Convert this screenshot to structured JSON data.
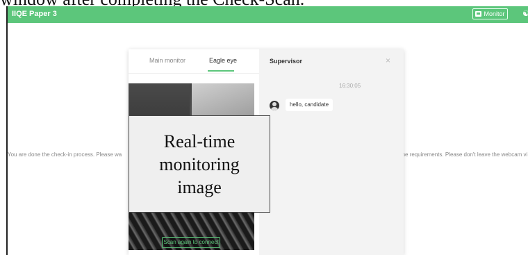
{
  "caption": "window after completing the Check-Scan.",
  "app": {
    "title": "IIQE Paper 3",
    "monitor_label": "Monitor",
    "monitor_icon": "monitor-icon",
    "wifi_icon": "wifi-icon"
  },
  "background": {
    "left_text": "You are done the check-in process. Please wa",
    "right_text": "ent meet the requirements. Please don't leave the webcam vi"
  },
  "dialog": {
    "tabs": [
      {
        "label": "Main monitor",
        "active": false
      },
      {
        "label": "Eagle eye",
        "active": true
      }
    ],
    "scan_again": "Scan again to connect",
    "chat": {
      "title": "Supervisor",
      "time": "16:30:05",
      "message": "hello, candidate"
    }
  },
  "overlay": {
    "line1": "Real-time",
    "line2": "monitoring",
    "line3": "image"
  },
  "colors": {
    "accent": "#5cc67b"
  }
}
